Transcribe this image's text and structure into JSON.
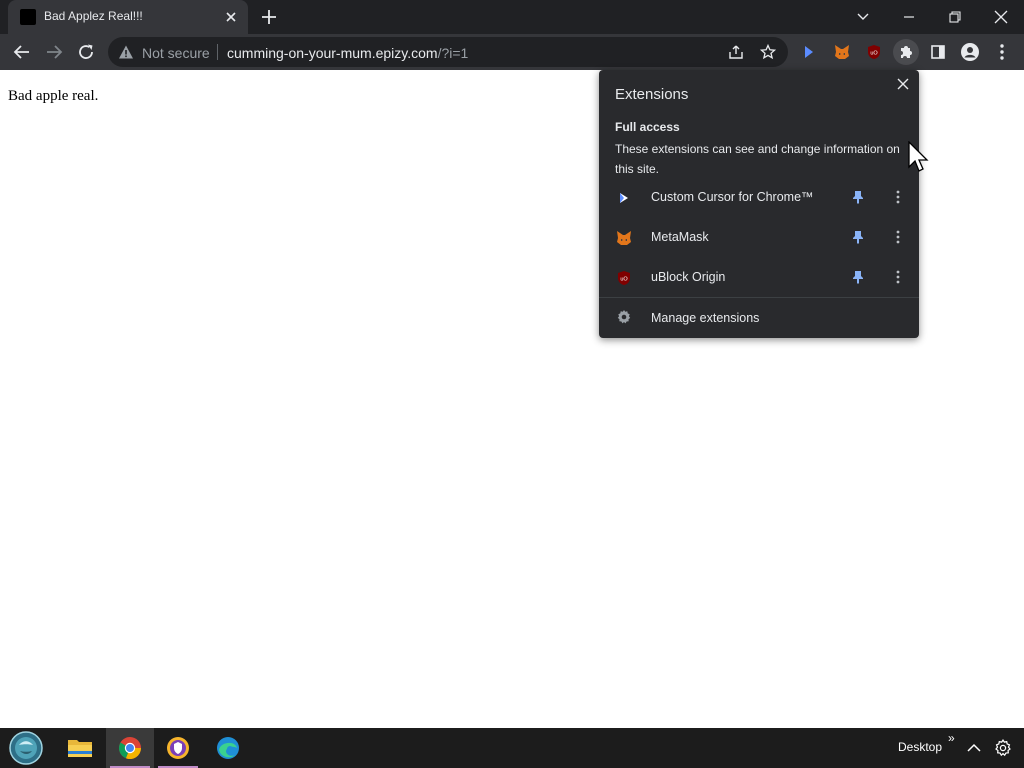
{
  "browser": {
    "tab": {
      "title": "Bad Applez Real!!!"
    },
    "omnibox": {
      "security_label": "Not secure",
      "url_host": "cumming-on-your-mum.epizy.com",
      "url_path": "/?i=1"
    }
  },
  "page": {
    "text": "Bad apple real."
  },
  "extensions_popup": {
    "title": "Extensions",
    "section_title": "Full access",
    "section_description": "These extensions can see and change information on this site.",
    "items": [
      {
        "name": "Custom Cursor for Chrome™",
        "icon": "custom-cursor-icon"
      },
      {
        "name": "MetaMask",
        "icon": "metamask-fox-icon"
      },
      {
        "name": "uBlock Origin",
        "icon": "ublock-origin-icon"
      }
    ],
    "manage_label": "Manage extensions"
  },
  "taskbar": {
    "desktop_label": "Desktop",
    "overflow_label": "»"
  },
  "colors": {
    "titlebar": "#202124",
    "toolbar": "#35363a",
    "popup_bg": "#292a2d",
    "pin_blue": "#8ab4f8",
    "taskbar": "#1c1c1c"
  }
}
